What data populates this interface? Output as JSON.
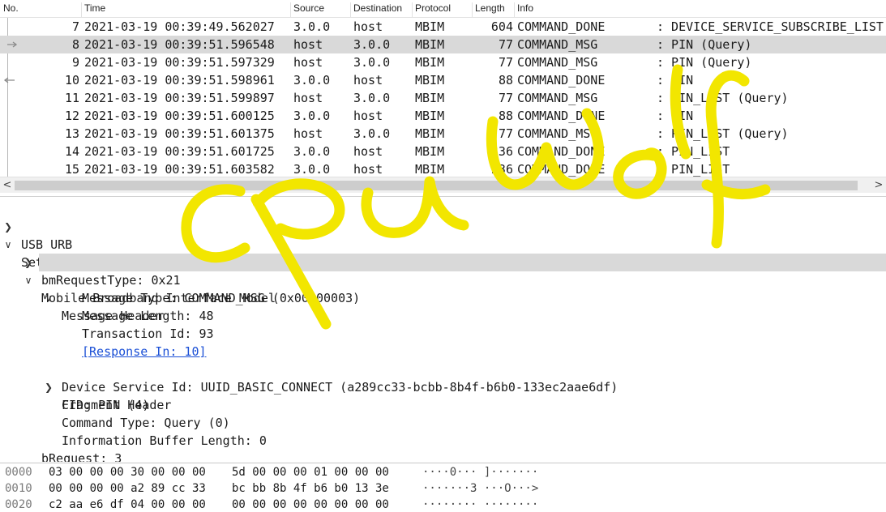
{
  "packet_list": {
    "columns": [
      "No.",
      "Time",
      "Source",
      "Destination",
      "Protocol",
      "Length",
      "Info"
    ],
    "rows": [
      {
        "no": "7",
        "time": "2021-03-19 00:39:49.562027",
        "src": "3.0.0",
        "dst": "host",
        "proto": "MBIM",
        "len": "604",
        "type": "COMMAND_DONE",
        "info": ": DEVICE_SERVICE_SUBSCRIBE_LIST"
      },
      {
        "no": "8",
        "time": "2021-03-19 00:39:51.596548",
        "src": "host",
        "dst": "3.0.0",
        "proto": "MBIM",
        "len": "77",
        "type": "COMMAND_MSG",
        "info": ": PIN (Query)"
      },
      {
        "no": "9",
        "time": "2021-03-19 00:39:51.597329",
        "src": "host",
        "dst": "3.0.0",
        "proto": "MBIM",
        "len": "77",
        "type": "COMMAND_MSG",
        "info": ": PIN (Query)"
      },
      {
        "no": "10",
        "time": "2021-03-19 00:39:51.598961",
        "src": "3.0.0",
        "dst": "host",
        "proto": "MBIM",
        "len": "88",
        "type": "COMMAND_DONE",
        "info": ": PIN"
      },
      {
        "no": "11",
        "time": "2021-03-19 00:39:51.599897",
        "src": "host",
        "dst": "3.0.0",
        "proto": "MBIM",
        "len": "77",
        "type": "COMMAND_MSG",
        "info": ": PIN_LIST (Query)"
      },
      {
        "no": "12",
        "time": "2021-03-19 00:39:51.600125",
        "src": "3.0.0",
        "dst": "host",
        "proto": "MBIM",
        "len": "88",
        "type": "COMMAND_DONE",
        "info": ": PIN"
      },
      {
        "no": "13",
        "time": "2021-03-19 00:39:51.601375",
        "src": "host",
        "dst": "3.0.0",
        "proto": "MBIM",
        "len": "77",
        "type": "COMMAND_MSG",
        "info": ": PIN_LIST (Query)"
      },
      {
        "no": "14",
        "time": "2021-03-19 00:39:51.601725",
        "src": "3.0.0",
        "dst": "host",
        "proto": "MBIM",
        "len": "236",
        "type": "COMMAND_DONE",
        "info": ": PIN_LIST"
      },
      {
        "no": "15",
        "time": "2021-03-19 00:39:51.603582",
        "src": "3.0.0",
        "dst": "host",
        "proto": "MBIM",
        "len": "236",
        "type": "COMMAND_DONE",
        "info": ": PIN_LIST"
      }
    ],
    "scroll_left": "<",
    "scroll_right": ">"
  },
  "details": {
    "usb_urb": "USB URB",
    "setup_data": "Setup Data",
    "bm_request_type": "bmRequestType: 0x21",
    "mbim": "Mobile Broadband Interface Model",
    "message_header": "Message Header",
    "message_type": "Message Type: COMMAND_MSG (0x00000003)",
    "message_length": "Message Length: 48",
    "transaction_id": "Transaction Id: 93",
    "response_in": "[Response In: 10]",
    "fragment_header": "Fragment Header",
    "device_service_id": "Device Service Id: UUID_BASIC_CONNECT (a289cc33-bcbb-8b4f-b6b0-133ec2aae6df)",
    "cid": "CID: PIN (4)",
    "command_type": "Command Type: Query (0)",
    "info_buffer_length": "Information Buffer Length: 0",
    "b_request_partial": "bRequest: 3"
  },
  "hex": {
    "rows": [
      {
        "offset": "0000",
        "bytes1": "03 00 00 00 30 00 00 00",
        "bytes2": "5d 00 00 00 01 00 00 00",
        "ascii": "····0··· ]·······"
      },
      {
        "offset": "0010",
        "bytes1": "00 00 00 00 a2 89 cc 33",
        "bytes2": "bc bb 8b 4f b6 b0 13 3e",
        "ascii": "·······3 ···O···>"
      },
      {
        "offset": "0020",
        "bytes1": "c2 aa e6 df 04 00 00 00",
        "bytes2": "00 00 00 00 00 00 00 00",
        "ascii": "········ ········"
      }
    ]
  },
  "watermark": {
    "text": "cpuwolf",
    "color": "#f2e600"
  },
  "colors": {
    "selected_row": "#d9d9d9",
    "link": "#1a4fd6"
  }
}
